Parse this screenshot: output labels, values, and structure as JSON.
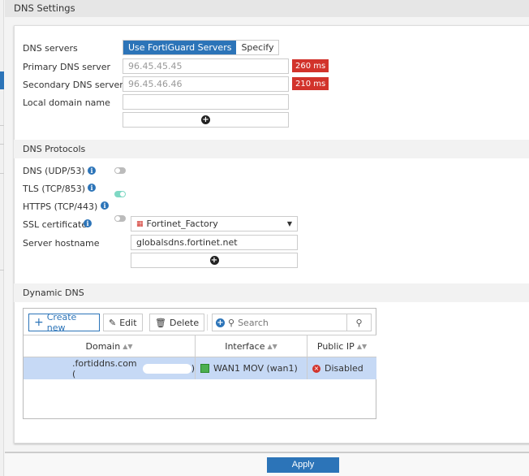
{
  "header": {
    "title": "DNS Settings"
  },
  "dns_servers": {
    "label": "DNS servers",
    "options": [
      "Use FortiGuard Servers",
      "Specify"
    ],
    "selected": "Use FortiGuard Servers",
    "primary_label": "Primary DNS server",
    "primary_value": "96.45.45.45",
    "primary_latency": "260 ms",
    "secondary_label": "Secondary DNS server",
    "secondary_value": "96.45.46.46",
    "secondary_latency": "210 ms",
    "local_domain_label": "Local domain name",
    "local_domain_value": ""
  },
  "protocols": {
    "title": "DNS Protocols",
    "items": [
      {
        "label": "DNS (UDP/53)",
        "enabled": false
      },
      {
        "label": "TLS (TCP/853)",
        "enabled": true
      },
      {
        "label": "HTTPS (TCP/443)",
        "enabled": false
      }
    ],
    "ssl_label": "SSL certificate",
    "ssl_value": "Fortinet_Factory",
    "hostname_label": "Server hostname",
    "hostname_value": "globalsdns.fortinet.net"
  },
  "ddns": {
    "title": "Dynamic DNS",
    "create": "Create new",
    "edit": "Edit",
    "delete": "Delete",
    "search_placeholder": "Search",
    "columns": [
      "Domain",
      "Interface",
      "Public IP"
    ],
    "rows": [
      {
        "domain": ".fortiddns.com (",
        "domain_end": ")",
        "interface": "WAN1  MOV (wan1)",
        "public_ip": "Disabled"
      }
    ]
  },
  "footer": {
    "apply": "Apply"
  },
  "colors": {
    "accent": "#2c74b8",
    "latency": "#d2332b",
    "toggle_on": "#7fd8c4",
    "row_selected": "#c6d9f5"
  }
}
